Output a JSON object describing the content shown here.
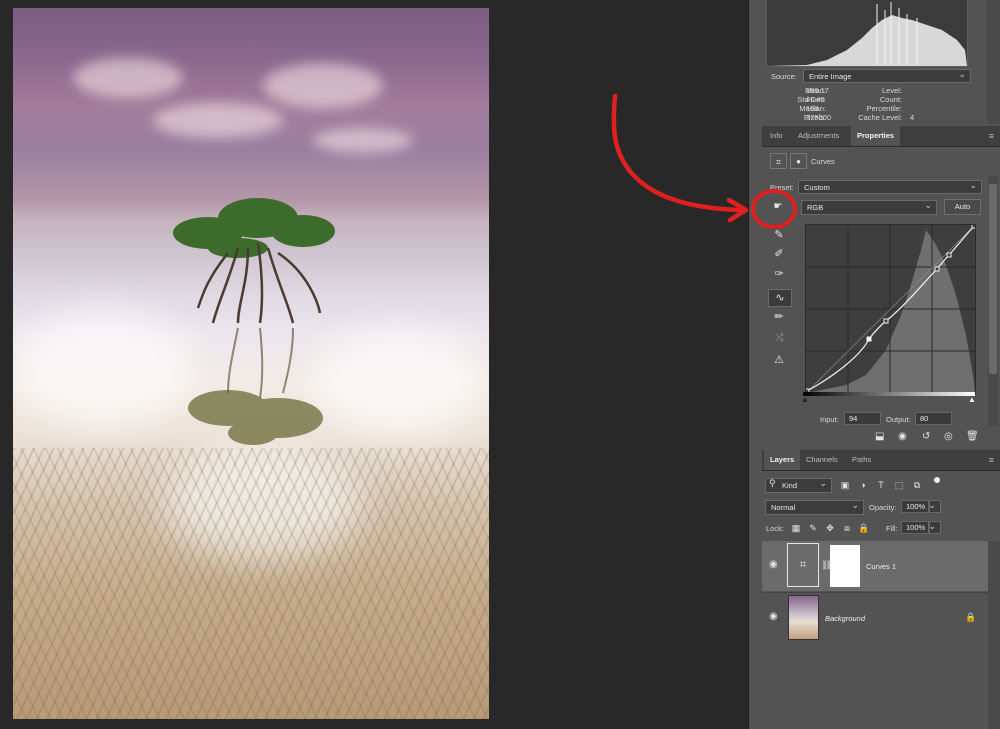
{
  "histogram": {
    "source_label": "Source:",
    "source_value": "Entire Image",
    "stats_left": [
      {
        "label": "Mean:",
        "value": "166.17"
      },
      {
        "label": "Std Dev:",
        "value": "46.45"
      },
      {
        "label": "Median:",
        "value": "168"
      },
      {
        "label": "Pixels:",
        "value": "375000"
      }
    ],
    "stats_right": [
      {
        "label": "Level:",
        "value": ""
      },
      {
        "label": "Count:",
        "value": ""
      },
      {
        "label": "Percentile:",
        "value": ""
      },
      {
        "label": "Cache Level:",
        "value": "4"
      }
    ]
  },
  "tabs_top": [
    "Info",
    "Adjustments",
    "Properties"
  ],
  "properties": {
    "title": "Curves",
    "preset_label": "Preset:",
    "preset_value": "Custom",
    "channel_value": "RGB",
    "auto_label": "Auto",
    "input_label": "Input:",
    "input_value": "94",
    "output_label": "Output:",
    "output_value": "80"
  },
  "tabs_layers": [
    "Layers",
    "Channels",
    "Paths"
  ],
  "layers": {
    "filter_value": "Kind",
    "blend_mode": "Normal",
    "opacity_label": "Opacity:",
    "opacity_value": "100%",
    "lock_label": "Lock:",
    "fill_label": "Fill:",
    "fill_value": "100%",
    "items": [
      {
        "name": "Curves 1"
      },
      {
        "name": "Background"
      }
    ]
  },
  "colors": {
    "annotation": "#e0201e",
    "panel": "#535353",
    "canvas_bg": "#282828"
  }
}
